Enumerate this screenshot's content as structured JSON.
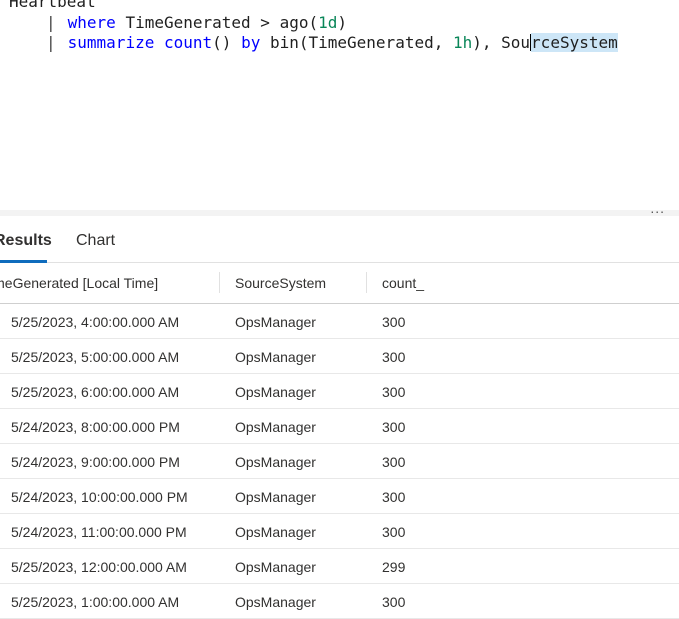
{
  "editor": {
    "line1": "Heartbeat",
    "line2": {
      "pipe": "|",
      "kw": "where",
      "rest": " TimeGenerated > ago(",
      "num": "1d",
      "close": ")"
    },
    "line3": {
      "pipe": "|",
      "kw1": "summarize",
      "fn": "count",
      "paren": "() ",
      "kw2": "by",
      "bin": " bin(TimeGenerated, ",
      "num": "1h",
      "after": "), Sou",
      "selected": "rceSystem"
    },
    "more_label": "..."
  },
  "tabs": [
    {
      "label": "Results"
    },
    {
      "label": "Chart"
    }
  ],
  "table": {
    "columns": [
      "TimeGenerated [Local Time]",
      "SourceSystem",
      "count_"
    ],
    "rows": [
      [
        "5/25/2023, 4:00:00.000 AM",
        "OpsManager",
        "300"
      ],
      [
        "5/25/2023, 5:00:00.000 AM",
        "OpsManager",
        "300"
      ],
      [
        "5/25/2023, 6:00:00.000 AM",
        "OpsManager",
        "300"
      ],
      [
        "5/24/2023, 8:00:00.000 PM",
        "OpsManager",
        "300"
      ],
      [
        "5/24/2023, 9:00:00.000 PM",
        "OpsManager",
        "300"
      ],
      [
        "5/24/2023, 10:00:00.000 PM",
        "OpsManager",
        "300"
      ],
      [
        "5/24/2023, 11:00:00.000 PM",
        "OpsManager",
        "300"
      ],
      [
        "5/25/2023, 12:00:00.000 AM",
        "OpsManager",
        "299"
      ],
      [
        "5/25/2023, 1:00:00.000 AM",
        "OpsManager",
        "300"
      ]
    ]
  },
  "colors": {
    "keyword": "#0000ff",
    "number": "#098658",
    "selection": "#cde6f7",
    "tab_accent": "#0f6cbd"
  }
}
